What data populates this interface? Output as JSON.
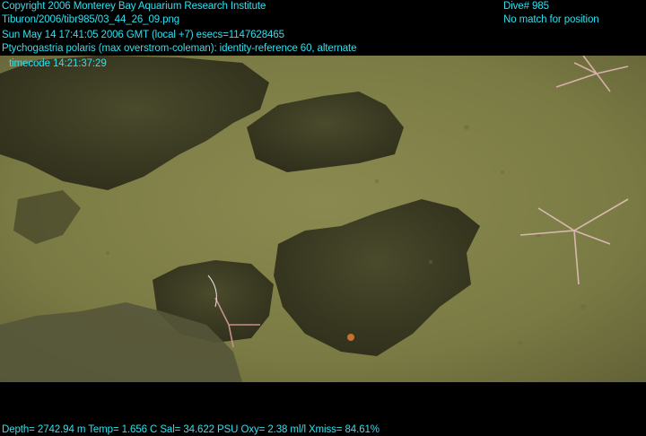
{
  "overlay": {
    "copyright": "Copyright 2006 Monterey Bay Aquarium Research Institute",
    "file_path": "Tiburon/2006/tibr985/03_44_26_09.png",
    "datetime": "Sun May 14 17:41:05 2006 GMT (local +7)  esecs=1147628465",
    "annotation": "Ptychogastria polaris (max overstrom-coleman): identity-reference 60, alternate",
    "timecode": "timecode 14:21:37:29",
    "dive": "Dive# 985",
    "position_status": "No match for position",
    "sensors": "Depth= 2742.94 m  Temp= 1.656 C  Sal= 34.622 PSU  Oxy= 2.38 ml/l  Xmiss= 84.61%"
  },
  "colors": {
    "overlay_text": "#2fe0ee",
    "background": "#000000",
    "seafloor": "#7c7c44",
    "rock": "#3e3e24"
  }
}
